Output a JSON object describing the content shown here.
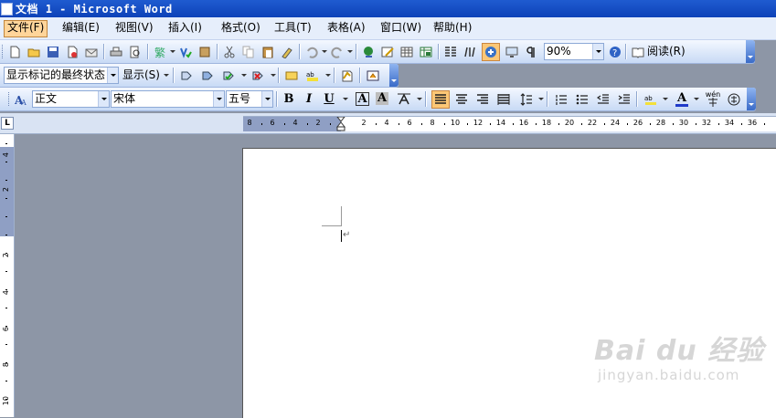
{
  "window": {
    "title": "文档 1 - Microsoft Word"
  },
  "menu": [
    "文件(F)",
    "编辑(E)",
    "视图(V)",
    "插入(I)",
    "格式(O)",
    "工具(T)",
    "表格(A)",
    "窗口(W)",
    "帮助(H)"
  ],
  "standard_toolbar": {
    "zoom": "90%",
    "read_label": "阅读(R)"
  },
  "review_toolbar": {
    "display_mode": "显示标记的最终状态",
    "show_label": "显示(S)"
  },
  "formatting_toolbar": {
    "style": "正文",
    "font": "宋体",
    "size": "五号",
    "bold": "B",
    "italic": "I",
    "underline": "U",
    "font_color_letter": "A",
    "char_border_letter": "A",
    "char_shading_letter": "A",
    "phonetic_label": "wén"
  },
  "ruler": {
    "tab_selector": "L",
    "h_labels": [
      "8",
      "6",
      "4",
      "2",
      "2",
      "4",
      "6",
      "8",
      "10",
      "12",
      "14",
      "16",
      "18",
      "20",
      "22",
      "24",
      "26",
      "28",
      "30",
      "32",
      "34",
      "36"
    ],
    "v_labels": [
      "4",
      "2",
      "2",
      "4",
      "6",
      "8",
      "10"
    ]
  },
  "watermark": {
    "logo": "Bai du 经验",
    "url": "jingyan.baidu.com"
  },
  "colors": {
    "title_bar": "#0d42b8",
    "menubar": "#e6eefb",
    "toolbar": "#c8daf5",
    "active_button": "#fbc776",
    "workspace": "#8d96a6"
  }
}
